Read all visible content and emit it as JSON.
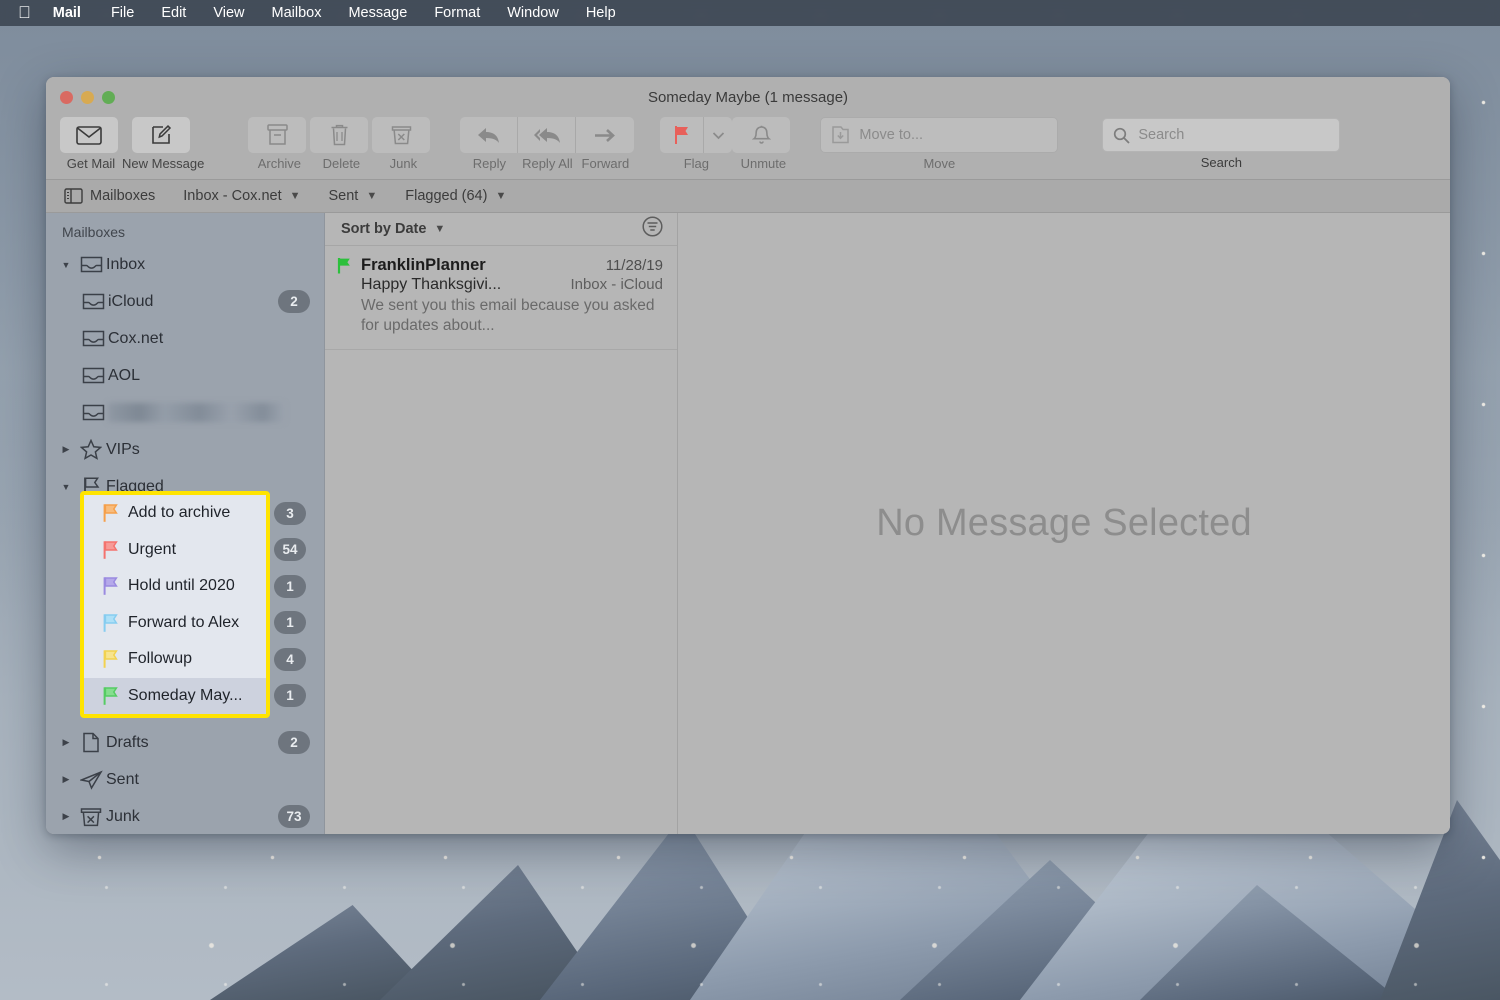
{
  "menubar": {
    "apple_icon": "apple-logo",
    "items": [
      {
        "label": "Mail",
        "bold": true
      },
      {
        "label": "File",
        "bold": false
      },
      {
        "label": "Edit",
        "bold": false
      },
      {
        "label": "View",
        "bold": false
      },
      {
        "label": "Mailbox",
        "bold": false
      },
      {
        "label": "Message",
        "bold": false
      },
      {
        "label": "Format",
        "bold": false
      },
      {
        "label": "Window",
        "bold": false
      },
      {
        "label": "Help",
        "bold": false
      }
    ]
  },
  "window": {
    "title": "Someday Maybe (1 message)",
    "traffic_lights": {
      "close_color": "#d96a62",
      "minimize_color": "#d8aa52",
      "zoom_color": "#62ad55"
    }
  },
  "toolbar": {
    "get_mail": "Get Mail",
    "new_message": "New Message",
    "archive": "Archive",
    "delete": "Delete",
    "junk": "Junk",
    "reply": "Reply",
    "reply_all": "Reply All",
    "forward": "Forward",
    "flag": "Flag",
    "unmute": "Unmute",
    "move_group_label": "Move",
    "move_to_placeholder": "Move to...",
    "search_group_label": "Search",
    "search_placeholder": "Search",
    "search_value": "",
    "flag_icon_color": "#e8605a"
  },
  "favorites_bar": {
    "mailboxes": "Mailboxes",
    "inbox": "Inbox - Cox.net",
    "sent": "Sent",
    "flagged": "Flagged (64)"
  },
  "sidebar": {
    "header": "Mailboxes",
    "items": [
      {
        "label": "Inbox",
        "icon": "inbox-icon",
        "badge": "",
        "indent": 0,
        "disclosure": "down"
      },
      {
        "label": "iCloud",
        "icon": "inbox-icon",
        "badge": "2",
        "indent": 1,
        "disclosure": "none"
      },
      {
        "label": "Cox.net",
        "icon": "inbox-icon",
        "badge": "",
        "indent": 1,
        "disclosure": "none"
      },
      {
        "label": "AOL",
        "icon": "inbox-icon",
        "badge": "",
        "indent": 1,
        "disclosure": "none"
      },
      {
        "label": "",
        "icon": "inbox-icon",
        "badge": "",
        "indent": 1,
        "disclosure": "none",
        "redacted": true
      },
      {
        "label": "VIPs",
        "icon": "star-icon",
        "badge": "",
        "indent": 0,
        "disclosure": "right"
      },
      {
        "label": "Flagged",
        "icon": "flag-icon",
        "badge": "",
        "indent": 0,
        "disclosure": "down"
      }
    ],
    "bottom_items": [
      {
        "label": "Drafts",
        "icon": "drafts-icon",
        "badge": "2",
        "disclosure": "right"
      },
      {
        "label": "Sent",
        "icon": "sent-icon",
        "badge": "",
        "disclosure": "right"
      },
      {
        "label": "Junk",
        "icon": "junk-icon",
        "badge": "73",
        "disclosure": "right"
      }
    ],
    "flag_group": {
      "highlight_color": "#ffe400",
      "items": [
        {
          "label": "Add to archive",
          "badge": "3",
          "color": "#f5a04b",
          "selected": false
        },
        {
          "label": "Urgent",
          "badge": "54",
          "color": "#f4736e",
          "selected": false
        },
        {
          "label": "Hold until 2020",
          "badge": "1",
          "color": "#9a8ae0",
          "selected": false
        },
        {
          "label": "Forward to Alex",
          "badge": "1",
          "color": "#86cdf0",
          "selected": false
        },
        {
          "label": "Followup",
          "badge": "4",
          "color": "#f2d24f",
          "selected": false
        },
        {
          "label": "Someday May...",
          "badge": "1",
          "color": "#55cc63",
          "selected": true
        }
      ]
    }
  },
  "message_list": {
    "sort_label": "Sort by Date",
    "filter_icon": "filter-icon",
    "messages": [
      {
        "sender": "FranklinPlanner",
        "date": "11/28/19",
        "subject": "Happy Thanksgivi...",
        "mailbox": "Inbox - iCloud",
        "preview": "We sent you this email because you asked for updates about...",
        "flag_color": "#2cc03c"
      }
    ]
  },
  "reading_pane": {
    "empty_text": "No Message Selected"
  }
}
